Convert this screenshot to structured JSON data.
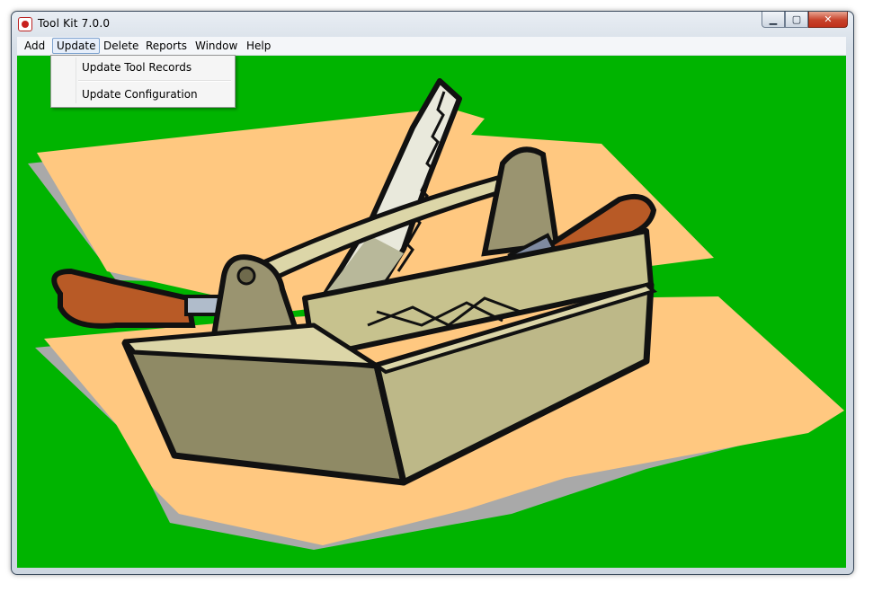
{
  "window": {
    "title": "Tool Kit  7.0.0",
    "controls": {
      "minimize": "▁",
      "maximize": "▢",
      "close": "✕"
    }
  },
  "menu": {
    "items": [
      "Add",
      "Update",
      "Delete",
      "Reports",
      "Window",
      "Help"
    ],
    "active": "Update"
  },
  "dropdown": {
    "items": [
      "Update Tool Records",
      "Update Configuration"
    ]
  },
  "colors": {
    "background": "#00b400",
    "paper": "#ffc880",
    "toolbox": "#8f8a65"
  },
  "icons": [
    "app-icon",
    "toolbox-illustration",
    "saw-icon",
    "screwdriver-icon",
    "chisel-icon"
  ]
}
